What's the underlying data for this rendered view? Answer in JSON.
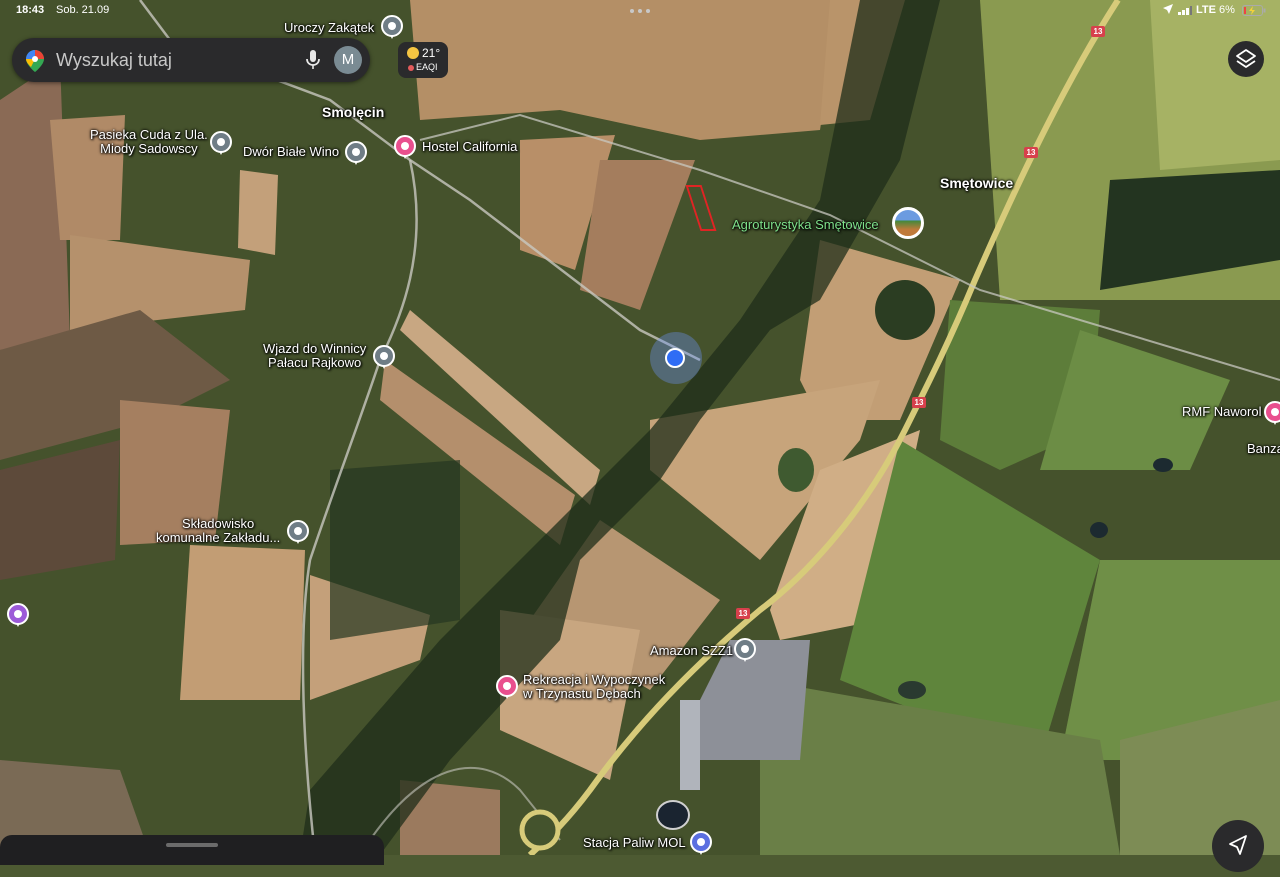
{
  "status_bar": {
    "time": "18:43",
    "date": "Sob. 21.09",
    "network": "LTE",
    "battery": "6%"
  },
  "search": {
    "placeholder": "Wyszukaj tutaj",
    "avatar_letter": "M"
  },
  "weather": {
    "temperature": "21°",
    "air_quality": "EAQI"
  },
  "colors": {
    "search_bg": "#2a2a2c",
    "route_badge": "#d7404c",
    "my_location": "#2f6df5",
    "poi_gray": "#6f7d86",
    "poi_pink": "#e94f8e",
    "poi_purple": "#9c5ad8",
    "poi_blue": "#5b6fe0",
    "label_green": "#7ee08a"
  },
  "map": {
    "towns": {
      "smolecin": "Smolęcin",
      "smetowice": "Smętowice"
    },
    "route_number": "13",
    "places": {
      "uroczy": "Uroczy Zakątek",
      "pasieka_l1": "Pasieka Cuda z Ula.",
      "pasieka_l2": "Miody Sadowscy",
      "dwor": "Dwór Białe Wino",
      "hostel": "Hostel California",
      "agro": "Agroturystyka Smętowice",
      "wjazd_l1": "Wjazd do Winnicy",
      "wjazd_l2": "Pałacu Rajkowo",
      "sklad_l1": "Składowisko",
      "sklad_l2": "komunalne Zakładu...",
      "rmf": "RMF Naworol",
      "banza": "Banza",
      "amazon": "Amazon SZZ1",
      "rekreacja_l1": "Rekreacja i Wypoczynek",
      "rekreacja_l2": "w Trzynastu Dębach",
      "stacja": "Stacja Paliw MOL"
    }
  }
}
